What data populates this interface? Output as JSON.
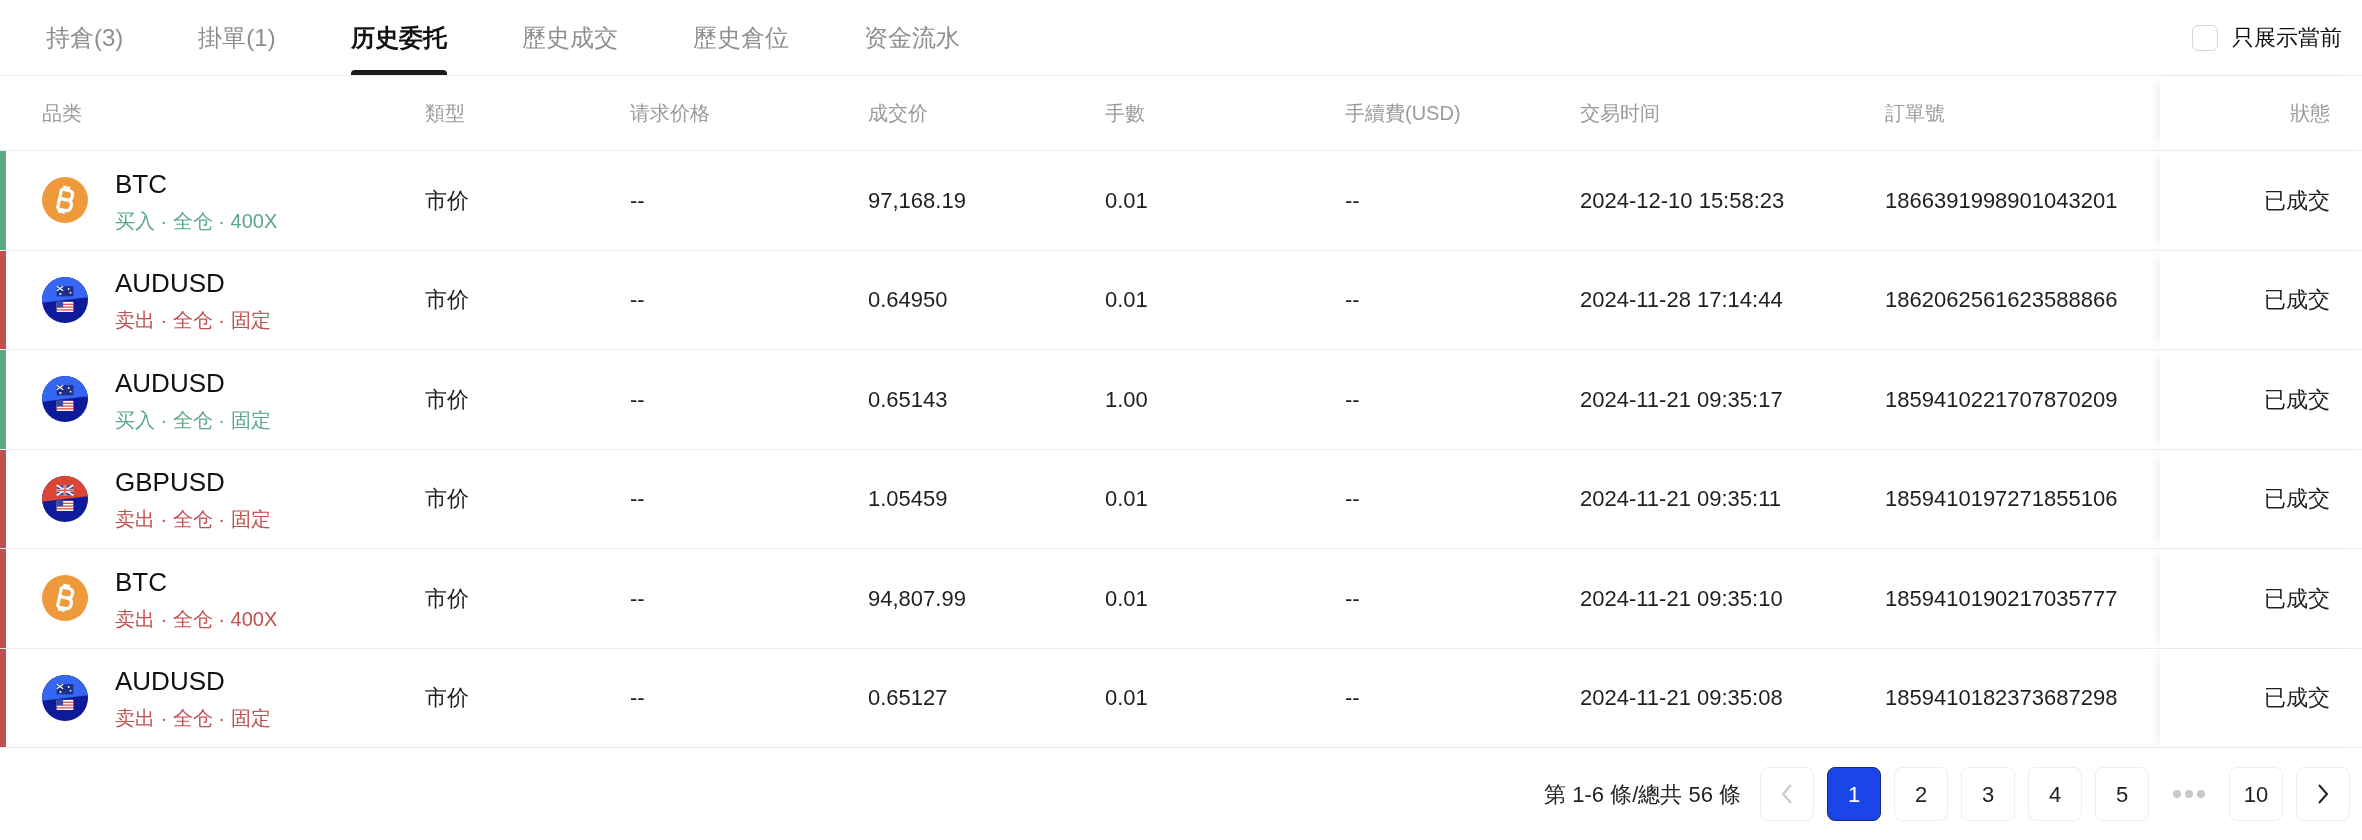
{
  "tabs": [
    {
      "label": "持倉(3)",
      "selected": false
    },
    {
      "label": "掛單(1)",
      "selected": false
    },
    {
      "label": "历史委托",
      "selected": true
    },
    {
      "label": "歷史成交",
      "selected": false
    },
    {
      "label": "歷史倉位",
      "selected": false
    },
    {
      "label": "资金流水",
      "selected": false
    }
  ],
  "filter": {
    "label": "只展示當前",
    "checked": false
  },
  "table": {
    "columns": [
      "品类",
      "類型",
      "请求价格",
      "成交价",
      "手數",
      "手續費(USD)",
      "交易时间",
      "訂單號",
      "狀態"
    ],
    "rows": [
      {
        "color": "#5ba887",
        "kind": "crypto",
        "symbol": "BTC",
        "detail": "买入 · 全仓 · 400X",
        "type": "市价",
        "request_price": "--",
        "price": "97,168.19",
        "lots": "0.01",
        "fee": "--",
        "time": "2024-12-10 15:58:23",
        "order_no": "1866391998901043201",
        "status": "已成交"
      },
      {
        "color": "#c0504f",
        "kind": "aud",
        "symbol": "AUDUSD",
        "detail": "卖出 · 全仓 · 固定",
        "type": "市价",
        "request_price": "--",
        "price": "0.64950",
        "lots": "0.01",
        "fee": "--",
        "time": "2024-11-28 17:14:44",
        "order_no": "1862062561623588866",
        "status": "已成交"
      },
      {
        "color": "#5ba887",
        "kind": "aud",
        "symbol": "AUDUSD",
        "detail": "买入 · 全仓 · 固定",
        "type": "市价",
        "request_price": "--",
        "price": "0.65143",
        "lots": "1.00",
        "fee": "--",
        "time": "2024-11-21 09:35:17",
        "order_no": "1859410221707870209",
        "status": "已成交"
      },
      {
        "color": "#c0504f",
        "kind": "gbp",
        "symbol": "GBPUSD",
        "detail": "卖出 · 全仓 · 固定",
        "type": "市价",
        "request_price": "--",
        "price": "1.05459",
        "lots": "0.01",
        "fee": "--",
        "time": "2024-11-21 09:35:11",
        "order_no": "1859410197271855106",
        "status": "已成交"
      },
      {
        "color": "#c0504f",
        "kind": "crypto",
        "symbol": "BTC",
        "detail": "卖出 · 全仓 · 400X",
        "type": "市价",
        "request_price": "--",
        "price": "94,807.99",
        "lots": "0.01",
        "fee": "--",
        "time": "2024-11-21 09:35:10",
        "order_no": "1859410190217035777",
        "status": "已成交"
      },
      {
        "color": "#c0504f",
        "kind": "aud",
        "symbol": "AUDUSD",
        "detail": "卖出 · 全仓 · 固定",
        "type": "市价",
        "request_price": "--",
        "price": "0.65127",
        "lots": "0.01",
        "fee": "--",
        "time": "2024-11-21 09:35:08",
        "order_no": "1859410182373687298",
        "status": "已成交"
      }
    ]
  },
  "pagination": {
    "summary": "第 1-6 條/總共 56 條",
    "prev_disabled": true,
    "next_disabled": false,
    "pages": [
      {
        "label": "1",
        "selected": true
      },
      {
        "label": "2",
        "selected": false
      },
      {
        "label": "3",
        "selected": false
      },
      {
        "label": "4",
        "selected": false
      },
      {
        "label": "5",
        "selected": false
      },
      {
        "kind": "ellipsis"
      },
      {
        "label": "10",
        "selected": false
      }
    ]
  }
}
